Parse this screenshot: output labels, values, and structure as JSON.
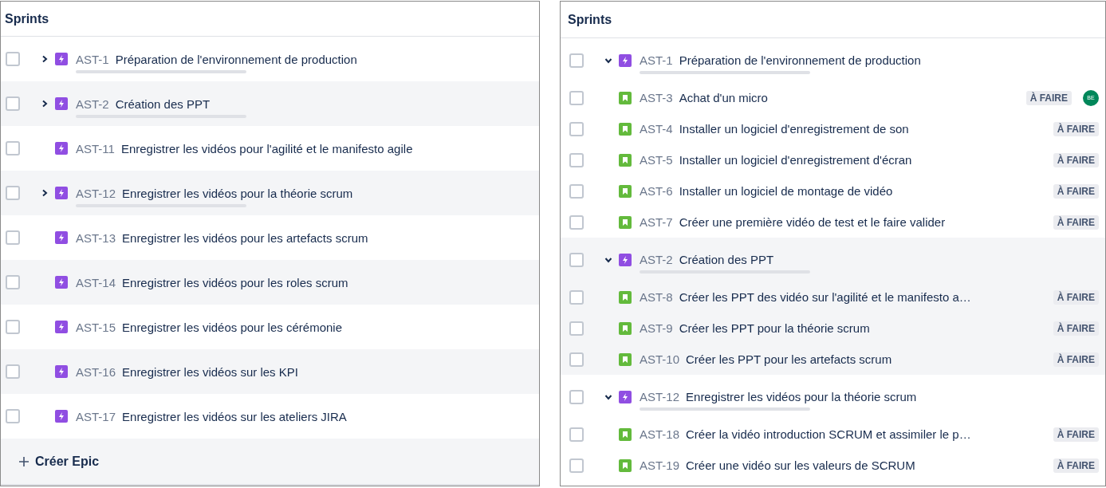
{
  "panels": [
    {
      "title": "Sprints",
      "items": [
        {
          "kind": "epic",
          "key": "AST-1",
          "summary": "Préparation de l'environnement de production",
          "checked": false,
          "expanded": false,
          "level": 0
        },
        {
          "kind": "epic",
          "key": "AST-2",
          "summary": "Création des PPT",
          "checked": false,
          "expanded": false,
          "level": 0
        },
        {
          "kind": "epic",
          "key": "AST-11",
          "summary": "Enregistrer les vidéos pour l'agilité et le manifesto agile",
          "checked": false
        },
        {
          "kind": "epic",
          "key": "AST-12",
          "summary": "Enregistrer les vidéos pour la théorie scrum",
          "checked": false,
          "expanded": false,
          "level": 0
        },
        {
          "kind": "epic",
          "key": "AST-13",
          "summary": "Enregistrer les vidéos pour les artefacts scrum",
          "checked": false
        },
        {
          "kind": "epic",
          "key": "AST-14",
          "summary": "Enregistrer les vidéos pour les roles scrum",
          "checked": false
        },
        {
          "kind": "epic",
          "key": "AST-15",
          "summary": "Enregistrer les vidéos pour les cérémonie",
          "checked": false
        },
        {
          "kind": "epic",
          "key": "AST-16",
          "summary": "Enregistrer les vidéos sur les KPI",
          "checked": false
        },
        {
          "kind": "epic",
          "key": "AST-17",
          "summary": "Enregistrer les vidéos sur les ateliers JIRA",
          "checked": false
        }
      ],
      "footer": {
        "label": "Créer Epic"
      }
    },
    {
      "title": "Sprints",
      "items": [
        {
          "kind": "epic",
          "key": "AST-1",
          "summary": "Préparation de l'environnement de production",
          "checked": false,
          "expanded": true,
          "level": 0,
          "children": [
            {
              "kind": "story",
              "key": "AST-3",
              "summary": "Achat d'un micro",
              "checked": false,
              "status": "À FAIRE",
              "assignee": "BE"
            },
            {
              "kind": "story",
              "key": "AST-4",
              "summary": "Installer un logiciel d'enregistrement de son",
              "checked": false,
              "status": "À FAIRE"
            },
            {
              "kind": "story",
              "key": "AST-5",
              "summary": "Installer un logiciel d'enregistrement d'écran",
              "checked": false,
              "status": "À FAIRE"
            },
            {
              "kind": "story",
              "key": "AST-6",
              "summary": "Installer un logiciel de montage de vidéo",
              "checked": false,
              "status": "À FAIRE"
            },
            {
              "kind": "story",
              "key": "AST-7",
              "summary": "Créer une première vidéo de test et le faire valider",
              "checked": false,
              "status": "À FAIRE"
            }
          ]
        },
        {
          "kind": "epic",
          "key": "AST-2",
          "summary": "Création des PPT",
          "checked": false,
          "expanded": true,
          "level": 0,
          "children": [
            {
              "kind": "story",
              "key": "AST-8",
              "summary": "Créer les PPT des vidéo sur l'agilité et le manifesto a…",
              "checked": false,
              "status": "À FAIRE"
            },
            {
              "kind": "story",
              "key": "AST-9",
              "summary": "Créer les PPT pour la théorie scrum",
              "checked": false,
              "status": "À FAIRE"
            },
            {
              "kind": "story",
              "key": "AST-10",
              "summary": "Créer les PPT pour les artefacts scrum",
              "checked": false,
              "status": "À FAIRE"
            }
          ]
        },
        {
          "kind": "epic",
          "key": "AST-12",
          "summary": "Enregistrer les vidéos pour la théorie scrum",
          "checked": false,
          "expanded": true,
          "level": 0,
          "children": [
            {
              "kind": "story",
              "key": "AST-18",
              "summary": "Créer la vidéo introduction SCRUM et assimiler le p…",
              "checked": false,
              "status": "À FAIRE"
            },
            {
              "kind": "story",
              "key": "AST-19",
              "summary": "Créer une vidéo sur les valeurs de SCRUM",
              "checked": false,
              "status": "À FAIRE"
            }
          ]
        }
      ]
    }
  ]
}
